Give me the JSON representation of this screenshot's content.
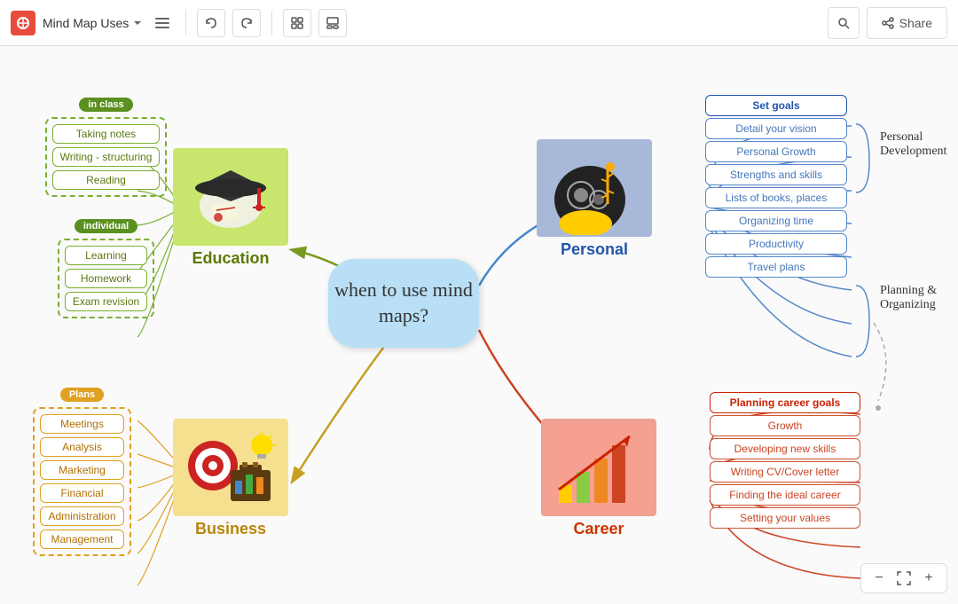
{
  "toolbar": {
    "logo": "M",
    "title": "Mind Map Uses",
    "share_label": "Share"
  },
  "center_node": {
    "text": "when to use\nmind maps?"
  },
  "education": {
    "label": "Education",
    "in_class_label": "in class",
    "in_class_items": [
      "Taking notes",
      "Writing - structuring",
      "Reading"
    ],
    "individual_label": "individual",
    "individual_items": [
      "Learning",
      "Homework",
      "Exam revision"
    ]
  },
  "business": {
    "label": "Business",
    "plans_label": "Plans",
    "items": [
      "Meetings",
      "Analysis",
      "Marketing",
      "Financial",
      "Administration",
      "Management"
    ]
  },
  "personal": {
    "label": "Personal",
    "items": [
      "Set goals",
      "Detail your vision",
      "Personal Growth",
      "Strengths and skills",
      "Lists of books, places",
      "Organizing time",
      "Productivity",
      "Travel plans"
    ],
    "right_label": "Personal\nDevelopment"
  },
  "career": {
    "label": "Career",
    "items": [
      "Planning career goals",
      "Growth",
      "Developing new skills",
      "Writing CV/Cover letter",
      "Finding the ideal career",
      "Setting  your values"
    ],
    "right_label": "Planning &\nOrganizing"
  },
  "zoom": {
    "minus": "−",
    "plus": "+"
  }
}
